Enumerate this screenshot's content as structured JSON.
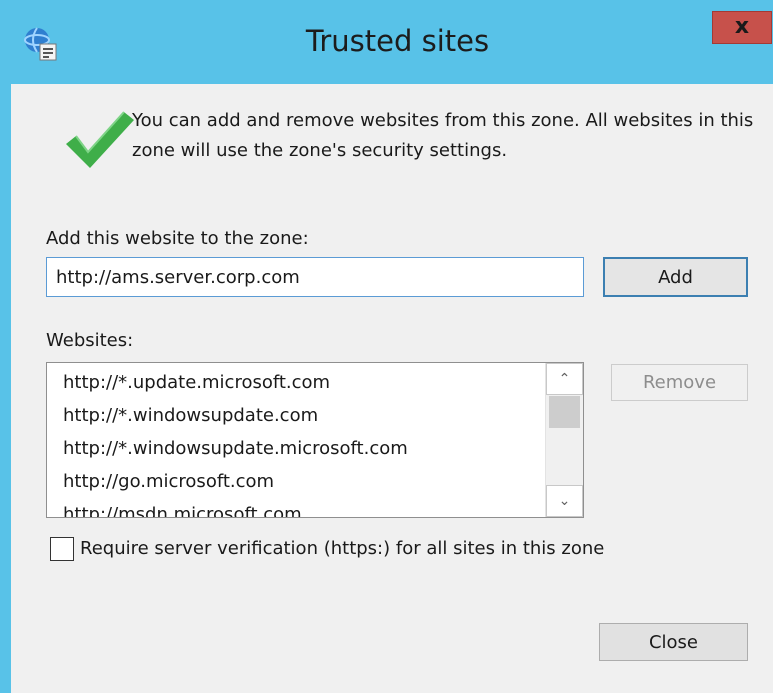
{
  "window": {
    "title": "Trusted sites",
    "close_glyph": "x"
  },
  "info": {
    "text": "You can add and remove websites from this zone. All websites in this zone will use the zone's security settings."
  },
  "add_section": {
    "label": "Add this website to the zone:",
    "url_value": "http://ams.server.corp.com",
    "add_button": "Add"
  },
  "websites": {
    "label": "Websites:",
    "items": [
      "http://*.update.microsoft.com",
      "http://*.windowsupdate.com",
      "http://*.windowsupdate.microsoft.com",
      "http://go.microsoft.com",
      "http://msdn.microsoft.com"
    ],
    "remove_button": "Remove",
    "scroll_up_glyph": "⌃",
    "scroll_down_glyph": "⌄"
  },
  "verification": {
    "label": "Require server verification (https:) for all sites in this zone",
    "checked": false
  },
  "footer": {
    "close_button": "Close"
  },
  "icons": {
    "app": "ie-security-icon",
    "check": "green-checkmark-icon"
  },
  "colors": {
    "titlebar": "#58c2e8",
    "close_button": "#c7514b",
    "check_green": "#3fae49",
    "input_border": "#5b9bd5"
  }
}
